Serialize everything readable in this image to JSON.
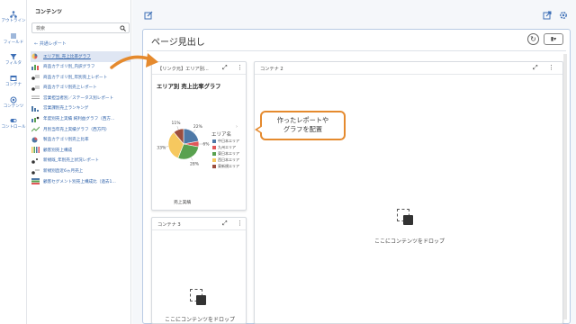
{
  "rail": {
    "items": [
      {
        "label": "アウトライン",
        "icon": "outline-icon"
      },
      {
        "label": "フィールド",
        "icon": "field-icon"
      },
      {
        "label": "フィルタ",
        "icon": "filter-icon"
      },
      {
        "label": "コンテナ",
        "icon": "container-icon"
      },
      {
        "label": "コンテンツ",
        "icon": "contents-icon"
      },
      {
        "label": "コントロール",
        "icon": "control-icon"
      }
    ]
  },
  "panel": {
    "title": "コンテンツ",
    "search_placeholder": "検索",
    "back_label": "共通レポート",
    "items": [
      {
        "label": "エリア別_売上比率グラフ",
        "icon": "pie-chart-icon",
        "selected": true
      },
      {
        "label": "商品カテゴリ別_内訳グラフ",
        "icon": "bar-chart-icon"
      },
      {
        "label": "商品カテゴリ別_年別売上レポート",
        "icon": "table-icon"
      },
      {
        "label": "商品カテゴリ別売上レポート",
        "icon": "table-icon"
      },
      {
        "label": "営業担当者別／ステータス別レポート",
        "icon": "crosstab-icon"
      },
      {
        "label": "営業課別売上ランキング",
        "icon": "ranking-icon"
      },
      {
        "label": "年度別売上実績 純利益グラフ（西方...",
        "icon": "combo-chart-icon"
      },
      {
        "label": "月別当年売上実績グラフ（西方円）",
        "icon": "line-chart-icon"
      },
      {
        "label": "製品カテゴリ別売上比率",
        "icon": "pie-chart-icon"
      },
      {
        "label": "顧客別売上構成",
        "icon": "stacked-bar-icon"
      },
      {
        "label": "新規既_年別売上状況レポート",
        "icon": "table-icon"
      },
      {
        "label": "新規別直近6ヵ月売上",
        "icon": "table-icon"
      },
      {
        "label": "顧客セグメント別売上構成比（過去1...",
        "icon": "stacked-bar-icon"
      }
    ]
  },
  "page": {
    "title": "ページ見出し"
  },
  "containers": [
    {
      "title": "【リンク元】エリア別...",
      "label": "コンテナ 1"
    },
    {
      "title": "コンテナ 2",
      "drop_text": "ここにコンテンツをドロップ"
    },
    {
      "title": "コンテナ 3",
      "drop_text": "ここにコンテンツをドロップ"
    }
  ],
  "chart_data": {
    "type": "pie",
    "title": "エリア別 売上比率グラフ",
    "legend_title": "エリア名",
    "legend_position": "right",
    "categories": [
      "中日本エリア",
      "九州エリア",
      "東日本エリア",
      "西日本エリア",
      "東新規エリア"
    ],
    "values": [
      22,
      6,
      28,
      33,
      11
    ],
    "colors": [
      "#4e79a7",
      "#e15759",
      "#59a14f",
      "#f6c85f",
      "#9c4e3e"
    ],
    "point_labels": [
      "22%",
      "6%",
      "28%",
      "33%",
      "11%"
    ],
    "xlabel": "売上実績"
  },
  "callout": {
    "text_line1": "作ったレポートや",
    "text_line2": "グラフを配置"
  },
  "colors": {
    "accent": "#3d6fb6",
    "callout": "#e58a2e"
  }
}
